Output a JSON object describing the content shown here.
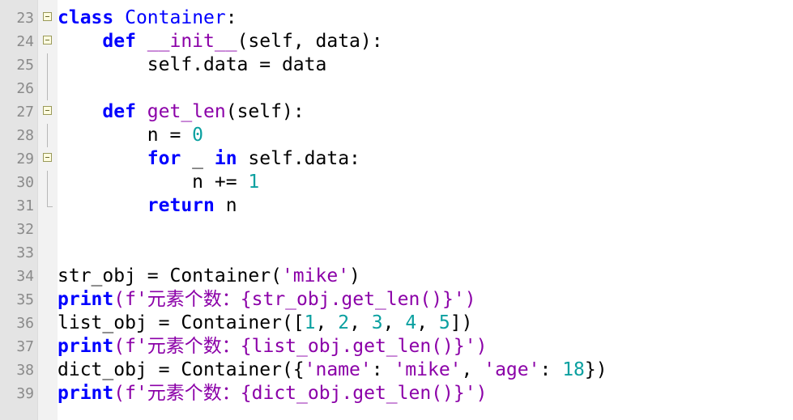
{
  "editor": {
    "colors": {
      "keyword": "#0000ff",
      "function": "#8b00a8",
      "string": "#8b00a8",
      "number": "#0aa0a0",
      "gutter": "#e4e4e4"
    },
    "lines": [
      {
        "no": "23",
        "fold": "open",
        "tokens": [
          {
            "t": "class",
            "c": "kw"
          },
          {
            "t": " ",
            "c": ""
          },
          {
            "t": "Container",
            "c": "cls"
          },
          {
            "t": ":",
            "c": ""
          }
        ]
      },
      {
        "no": "24",
        "fold": "open",
        "tokens": [
          {
            "t": "    ",
            "c": ""
          },
          {
            "t": "def",
            "c": "kw"
          },
          {
            "t": " ",
            "c": ""
          },
          {
            "t": "__init__",
            "c": "fn"
          },
          {
            "t": "(self, data):",
            "c": ""
          }
        ]
      },
      {
        "no": "25",
        "fold": "line",
        "tokens": [
          {
            "t": "        self.data = data",
            "c": ""
          }
        ]
      },
      {
        "no": "26",
        "fold": "line",
        "tokens": []
      },
      {
        "no": "27",
        "fold": "open",
        "tokens": [
          {
            "t": "    ",
            "c": ""
          },
          {
            "t": "def",
            "c": "kw"
          },
          {
            "t": " ",
            "c": ""
          },
          {
            "t": "get_len",
            "c": "fn"
          },
          {
            "t": "(self):",
            "c": ""
          }
        ]
      },
      {
        "no": "28",
        "fold": "line",
        "tokens": [
          {
            "t": "        n = ",
            "c": ""
          },
          {
            "t": "0",
            "c": "num"
          }
        ]
      },
      {
        "no": "29",
        "fold": "open",
        "tokens": [
          {
            "t": "        ",
            "c": ""
          },
          {
            "t": "for",
            "c": "kw"
          },
          {
            "t": " _ ",
            "c": ""
          },
          {
            "t": "in",
            "c": "kw"
          },
          {
            "t": " self.data:",
            "c": ""
          }
        ]
      },
      {
        "no": "30",
        "fold": "line",
        "tokens": [
          {
            "t": "            n += ",
            "c": ""
          },
          {
            "t": "1",
            "c": "num"
          }
        ]
      },
      {
        "no": "31",
        "fold": "end",
        "tokens": [
          {
            "t": "        ",
            "c": ""
          },
          {
            "t": "return",
            "c": "kw"
          },
          {
            "t": " n",
            "c": ""
          }
        ]
      },
      {
        "no": "32",
        "fold": "",
        "tokens": []
      },
      {
        "no": "33",
        "fold": "",
        "tokens": []
      },
      {
        "no": "34",
        "fold": "",
        "tokens": [
          {
            "t": "str_obj = Container(",
            "c": ""
          },
          {
            "t": "'mike'",
            "c": "str"
          },
          {
            "t": ")",
            "c": ""
          }
        ]
      },
      {
        "no": "35",
        "fold": "",
        "tokens": [
          {
            "t": "print",
            "c": "kw"
          },
          {
            "t": "(f'元素个数：{str_obj.get_len()}')",
            "c": "fstr"
          }
        ]
      },
      {
        "no": "36",
        "fold": "",
        "tokens": [
          {
            "t": "list_obj = Container([",
            "c": ""
          },
          {
            "t": "1",
            "c": "num"
          },
          {
            "t": ", ",
            "c": ""
          },
          {
            "t": "2",
            "c": "num"
          },
          {
            "t": ", ",
            "c": ""
          },
          {
            "t": "3",
            "c": "num"
          },
          {
            "t": ", ",
            "c": ""
          },
          {
            "t": "4",
            "c": "num"
          },
          {
            "t": ", ",
            "c": ""
          },
          {
            "t": "5",
            "c": "num"
          },
          {
            "t": "])",
            "c": ""
          }
        ]
      },
      {
        "no": "37",
        "fold": "",
        "tokens": [
          {
            "t": "print",
            "c": "kw"
          },
          {
            "t": "(f'元素个数：{list_obj.get_len()}')",
            "c": "fstr"
          }
        ]
      },
      {
        "no": "38",
        "fold": "",
        "tokens": [
          {
            "t": "dict_obj = Container({",
            "c": ""
          },
          {
            "t": "'name'",
            "c": "str"
          },
          {
            "t": ": ",
            "c": ""
          },
          {
            "t": "'mike'",
            "c": "str"
          },
          {
            "t": ", ",
            "c": ""
          },
          {
            "t": "'age'",
            "c": "str"
          },
          {
            "t": ": ",
            "c": ""
          },
          {
            "t": "18",
            "c": "num"
          },
          {
            "t": "})",
            "c": ""
          }
        ]
      },
      {
        "no": "39",
        "fold": "",
        "tokens": [
          {
            "t": "print",
            "c": "kw"
          },
          {
            "t": "(f'元素个数：{dict_obj.get_len()}')",
            "c": "fstr"
          }
        ]
      }
    ]
  }
}
